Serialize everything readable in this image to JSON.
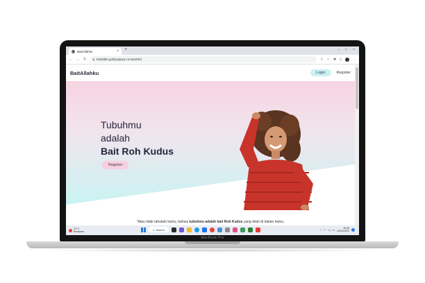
{
  "browser": {
    "tab_title": "BaitAllahku",
    "tab_close": "×",
    "new_tab": "+",
    "window_controls": [
      "–",
      "□",
      "×"
    ],
    "url": "baitallah.goldywijaya.com/public/"
  },
  "site": {
    "brand": "BaitAllahku",
    "nav_login": "Login",
    "nav_register": "Register",
    "hero_lines": [
      "Tubuhmu",
      "adalah",
      "Bait Roh Kudus"
    ],
    "hero_button": "Register",
    "quote_before": "\"Atau tidak tahukah kamu, bahwa ",
    "quote_bold": "tubuhmu adalah bait Roh Kudus",
    "quote_after": " yang diam di dalam kamu,"
  },
  "taskbar": {
    "weather_temp": "31°C",
    "weather_desc": "Berawan",
    "search_label": "Search",
    "time": "16.26",
    "date": "14/01/2022"
  },
  "device": {
    "model": "MacBook Pro"
  },
  "colors": {
    "hero_top": "#f8d4e2",
    "hero_bottom": "#c9f3f3",
    "login_button": "#c9f1f2",
    "register_button": "#f8cfdf",
    "sweater": "#c8342a"
  },
  "icons": [
    "back-arrow-icon",
    "forward-arrow-icon",
    "reload-icon",
    "lock-icon",
    "share-icon",
    "star-icon",
    "extensions-icon",
    "windows-logo-icon",
    "search-icon"
  ]
}
